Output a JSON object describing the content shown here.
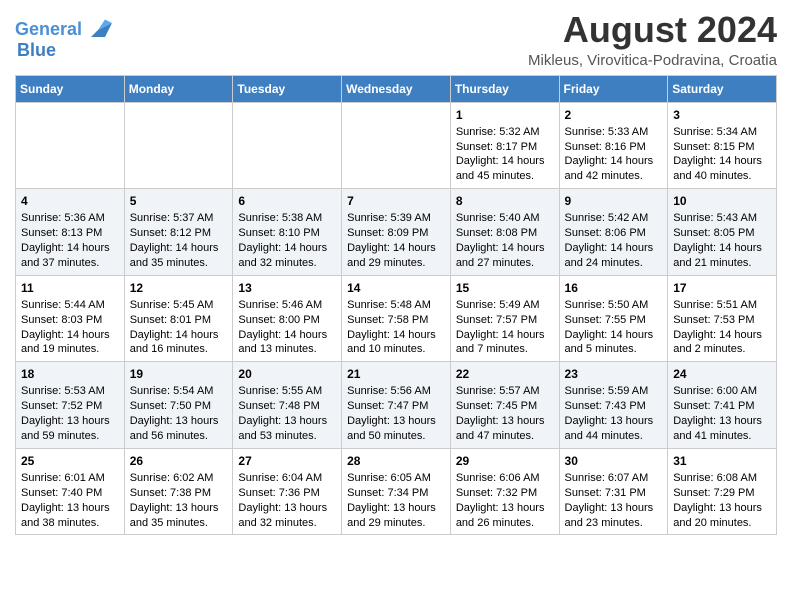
{
  "header": {
    "logo_line1": "General",
    "logo_line2": "Blue",
    "month_year": "August 2024",
    "subtitle": "Mikleus, Virovitica-Podravina, Croatia"
  },
  "weekdays": [
    "Sunday",
    "Monday",
    "Tuesday",
    "Wednesday",
    "Thursday",
    "Friday",
    "Saturday"
  ],
  "weeks": [
    [
      {
        "day": "",
        "content": ""
      },
      {
        "day": "",
        "content": ""
      },
      {
        "day": "",
        "content": ""
      },
      {
        "day": "",
        "content": ""
      },
      {
        "day": "1",
        "content": "Sunrise: 5:32 AM\nSunset: 8:17 PM\nDaylight: 14 hours\nand 45 minutes."
      },
      {
        "day": "2",
        "content": "Sunrise: 5:33 AM\nSunset: 8:16 PM\nDaylight: 14 hours\nand 42 minutes."
      },
      {
        "day": "3",
        "content": "Sunrise: 5:34 AM\nSunset: 8:15 PM\nDaylight: 14 hours\nand 40 minutes."
      }
    ],
    [
      {
        "day": "4",
        "content": "Sunrise: 5:36 AM\nSunset: 8:13 PM\nDaylight: 14 hours\nand 37 minutes."
      },
      {
        "day": "5",
        "content": "Sunrise: 5:37 AM\nSunset: 8:12 PM\nDaylight: 14 hours\nand 35 minutes."
      },
      {
        "day": "6",
        "content": "Sunrise: 5:38 AM\nSunset: 8:10 PM\nDaylight: 14 hours\nand 32 minutes."
      },
      {
        "day": "7",
        "content": "Sunrise: 5:39 AM\nSunset: 8:09 PM\nDaylight: 14 hours\nand 29 minutes."
      },
      {
        "day": "8",
        "content": "Sunrise: 5:40 AM\nSunset: 8:08 PM\nDaylight: 14 hours\nand 27 minutes."
      },
      {
        "day": "9",
        "content": "Sunrise: 5:42 AM\nSunset: 8:06 PM\nDaylight: 14 hours\nand 24 minutes."
      },
      {
        "day": "10",
        "content": "Sunrise: 5:43 AM\nSunset: 8:05 PM\nDaylight: 14 hours\nand 21 minutes."
      }
    ],
    [
      {
        "day": "11",
        "content": "Sunrise: 5:44 AM\nSunset: 8:03 PM\nDaylight: 14 hours\nand 19 minutes."
      },
      {
        "day": "12",
        "content": "Sunrise: 5:45 AM\nSunset: 8:01 PM\nDaylight: 14 hours\nand 16 minutes."
      },
      {
        "day": "13",
        "content": "Sunrise: 5:46 AM\nSunset: 8:00 PM\nDaylight: 14 hours\nand 13 minutes."
      },
      {
        "day": "14",
        "content": "Sunrise: 5:48 AM\nSunset: 7:58 PM\nDaylight: 14 hours\nand 10 minutes."
      },
      {
        "day": "15",
        "content": "Sunrise: 5:49 AM\nSunset: 7:57 PM\nDaylight: 14 hours\nand 7 minutes."
      },
      {
        "day": "16",
        "content": "Sunrise: 5:50 AM\nSunset: 7:55 PM\nDaylight: 14 hours\nand 5 minutes."
      },
      {
        "day": "17",
        "content": "Sunrise: 5:51 AM\nSunset: 7:53 PM\nDaylight: 14 hours\nand 2 minutes."
      }
    ],
    [
      {
        "day": "18",
        "content": "Sunrise: 5:53 AM\nSunset: 7:52 PM\nDaylight: 13 hours\nand 59 minutes."
      },
      {
        "day": "19",
        "content": "Sunrise: 5:54 AM\nSunset: 7:50 PM\nDaylight: 13 hours\nand 56 minutes."
      },
      {
        "day": "20",
        "content": "Sunrise: 5:55 AM\nSunset: 7:48 PM\nDaylight: 13 hours\nand 53 minutes."
      },
      {
        "day": "21",
        "content": "Sunrise: 5:56 AM\nSunset: 7:47 PM\nDaylight: 13 hours\nand 50 minutes."
      },
      {
        "day": "22",
        "content": "Sunrise: 5:57 AM\nSunset: 7:45 PM\nDaylight: 13 hours\nand 47 minutes."
      },
      {
        "day": "23",
        "content": "Sunrise: 5:59 AM\nSunset: 7:43 PM\nDaylight: 13 hours\nand 44 minutes."
      },
      {
        "day": "24",
        "content": "Sunrise: 6:00 AM\nSunset: 7:41 PM\nDaylight: 13 hours\nand 41 minutes."
      }
    ],
    [
      {
        "day": "25",
        "content": "Sunrise: 6:01 AM\nSunset: 7:40 PM\nDaylight: 13 hours\nand 38 minutes."
      },
      {
        "day": "26",
        "content": "Sunrise: 6:02 AM\nSunset: 7:38 PM\nDaylight: 13 hours\nand 35 minutes."
      },
      {
        "day": "27",
        "content": "Sunrise: 6:04 AM\nSunset: 7:36 PM\nDaylight: 13 hours\nand 32 minutes."
      },
      {
        "day": "28",
        "content": "Sunrise: 6:05 AM\nSunset: 7:34 PM\nDaylight: 13 hours\nand 29 minutes."
      },
      {
        "day": "29",
        "content": "Sunrise: 6:06 AM\nSunset: 7:32 PM\nDaylight: 13 hours\nand 26 minutes."
      },
      {
        "day": "30",
        "content": "Sunrise: 6:07 AM\nSunset: 7:31 PM\nDaylight: 13 hours\nand 23 minutes."
      },
      {
        "day": "31",
        "content": "Sunrise: 6:08 AM\nSunset: 7:29 PM\nDaylight: 13 hours\nand 20 minutes."
      }
    ]
  ]
}
